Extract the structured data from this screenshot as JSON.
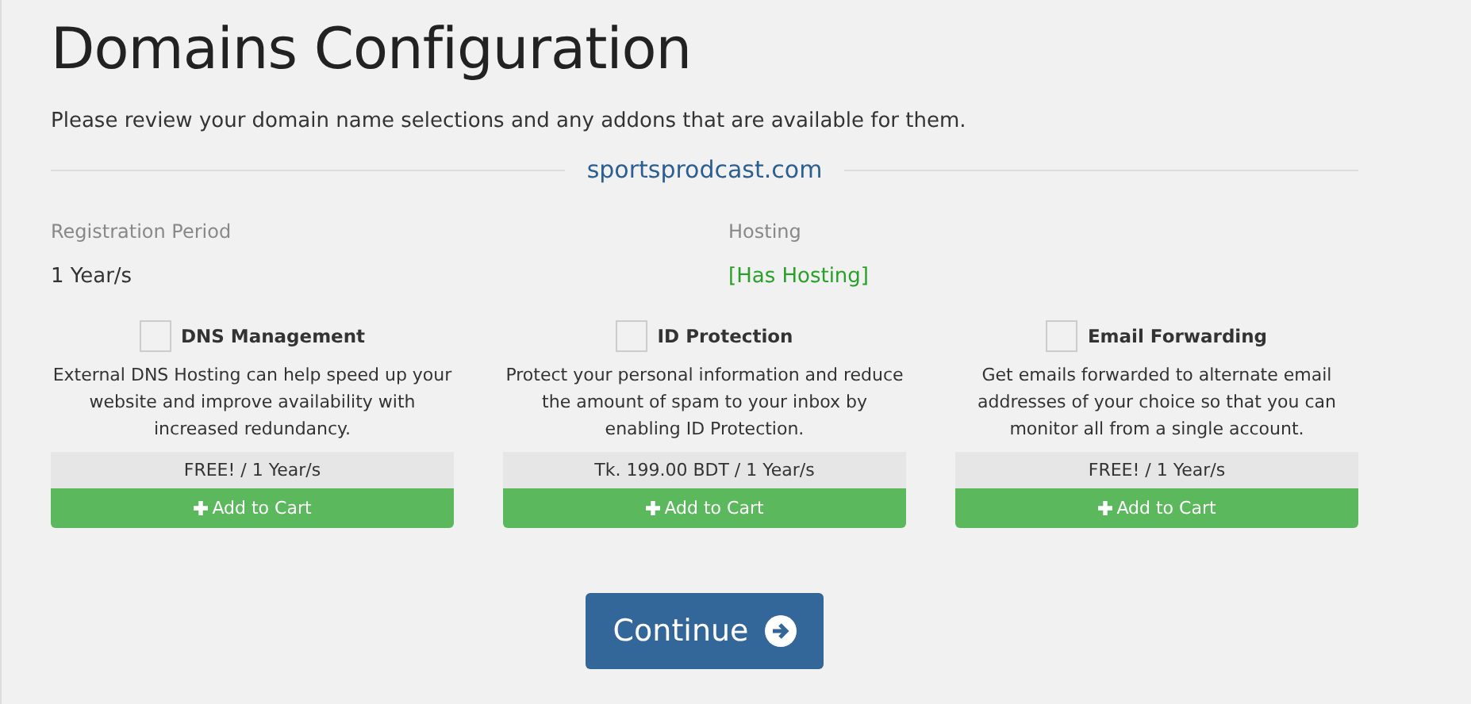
{
  "title": "Domains Configuration",
  "intro": "Please review your domain name selections and any addons that are available for them.",
  "domain": "sportsprodcast.com",
  "fields": [
    {
      "label": "Registration Period",
      "value": "1 Year/s",
      "kind": "plain"
    },
    {
      "label": "Hosting",
      "value": "[Has Hosting]",
      "kind": "status"
    }
  ],
  "addons": [
    {
      "name": "DNS Management",
      "checked": false,
      "description": "External DNS Hosting can help speed up your website and improve availability with increased redundancy.",
      "price": "FREE! / 1 Year/s",
      "button": "Add to Cart"
    },
    {
      "name": "ID Protection",
      "checked": false,
      "description": "Protect your personal information and reduce the amount of spam to your inbox by enabling ID Protection.",
      "price": "Tk. 199.00 BDT / 1 Year/s",
      "button": "Add to Cart"
    },
    {
      "name": "Email Forwarding",
      "checked": false,
      "description": "Get emails forwarded to alternate email addresses of your choice so that you can monitor all from a single account.",
      "price": "FREE! / 1 Year/s",
      "button": "Add to Cart"
    }
  ],
  "continue_button": "Continue"
}
